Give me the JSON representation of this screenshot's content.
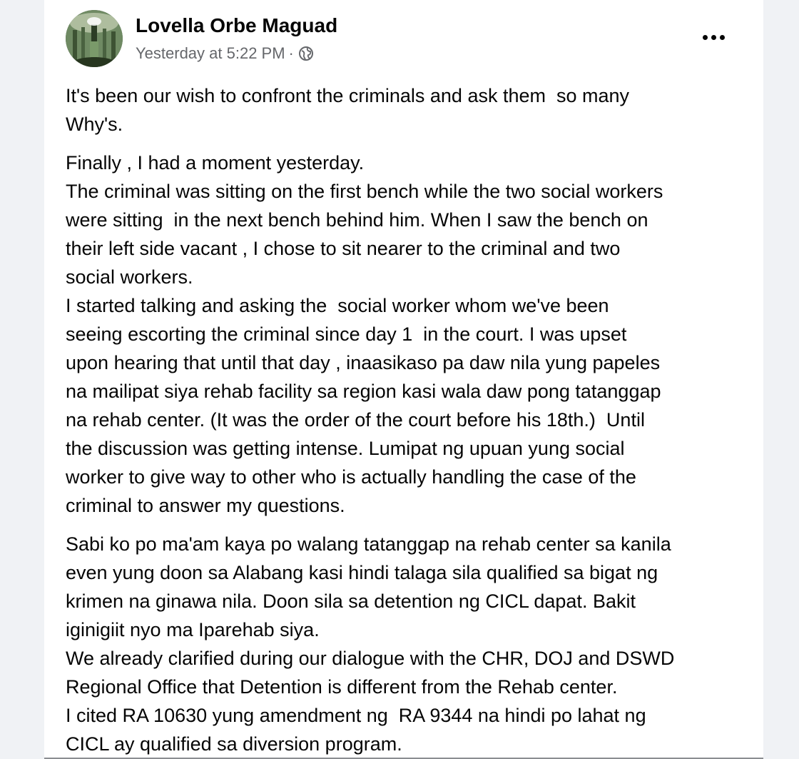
{
  "post": {
    "author": "Lovella Orbe Maguad",
    "timestamp": "Yesterday at 5:22 PM",
    "separator": "·",
    "privacy_icon": "globe-icon",
    "more_icon": "more-options-icon",
    "avatar_icon": "profile-photo",
    "paragraphs": [
      "It's been our wish to confront the criminals and ask them  so many\nWhy's.",
      "Finally , I had a moment yesterday.\nThe criminal was sitting on the first bench while the two social workers\nwere sitting  in the next bench behind him. When I saw the bench on\ntheir left side vacant , I chose to sit nearer to the criminal and two\nsocial workers.\nI started talking and asking the  social worker whom we've been\nseeing escorting the criminal since day 1  in the court. I was upset\nupon hearing that until that day , inaasikaso pa daw nila yung papeles\nna mailipat siya rehab facility sa region kasi wala daw pong tatanggap\nna rehab center. (It was the order of the court before his 18th.)  Until\nthe discussion was getting intense. Lumipat ng upuan yung social\nworker to give way to other who is actually handling the case of the\ncriminal to answer my questions.",
      "Sabi ko po ma'am kaya po walang tatanggap na rehab center sa kanila\neven yung doon sa Alabang kasi hindi talaga sila qualified sa bigat ng\nkrimen na ginawa nila. Doon sila sa detention ng CICL dapat. Bakit\niginigiit nyo ma Iparehab siya.\nWe already clarified during our dialogue with the CHR, DOJ and DSWD\nRegional Office that Detention is different from the Rehab center.\nI cited RA 10630 yung amendment ng  RA 9344 na hindi po lahat ng\nCICL ay qualified sa diversion program."
    ]
  },
  "colors": {
    "background": "#f0f2f5",
    "card": "#ffffff",
    "text": "#050505",
    "meta_text": "#65676b"
  }
}
